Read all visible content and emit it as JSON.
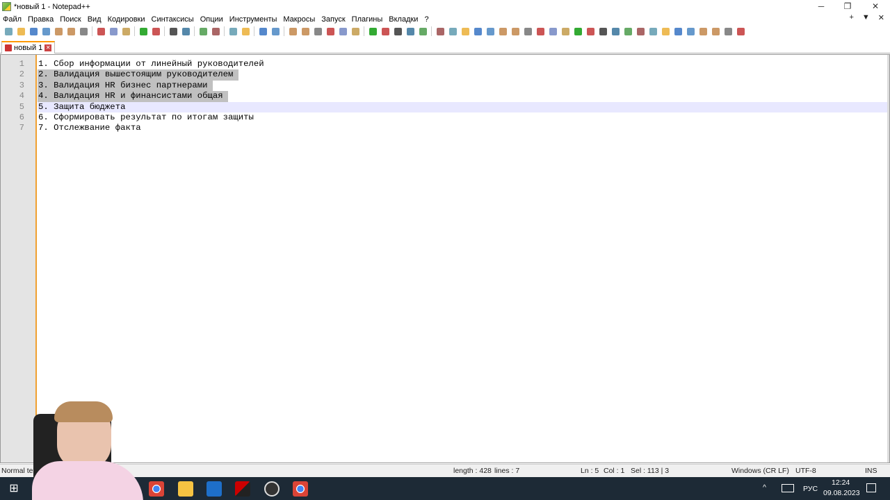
{
  "window": {
    "title": "*новый 1 - Notepad++",
    "minimize": "─",
    "restore": "❐",
    "close": "✕"
  },
  "menu": [
    "Файл",
    "Правка",
    "Поиск",
    "Вид",
    "Кодировки",
    "Синтаксисы",
    "Опции",
    "Инструменты",
    "Макросы",
    "Запуск",
    "Плагины",
    "Вкладки",
    "?"
  ],
  "menu_right": {
    "add": "+",
    "dropdown": "▼",
    "close": "✕"
  },
  "toolbar_icons": [
    "new-file-icon",
    "open-file-icon",
    "save-icon",
    "save-all-icon",
    "close-icon",
    "close-all-icon",
    "print-icon",
    "cut-icon",
    "copy-icon",
    "paste-icon",
    "undo-icon",
    "redo-icon",
    "find-icon",
    "replace-icon",
    "zoom-in-icon",
    "zoom-out-icon",
    "sync-vertical-icon",
    "sync-horizontal-icon",
    "word-wrap-icon",
    "show-all-chars-icon",
    "indent-guide-icon",
    "lang-icon",
    "doc-map-icon",
    "function-list-icon",
    "folder-workspace-icon",
    "monitor-icon",
    "record-macro-icon",
    "stop-macro-icon",
    "play-macro-icon",
    "run-macro-multiple-icon",
    "save-macro-icon",
    "plugin-icon",
    "plugin-icon",
    "plugin-icon",
    "plugin-icon",
    "plugin-icon",
    "plugin-icon",
    "plugin-icon",
    "plugin-icon",
    "plugin-icon",
    "plugin-icon",
    "plugin-icon",
    "plugin-icon",
    "plugin-icon",
    "plugin-icon",
    "plugin-icon",
    "plugin-icon",
    "plugin-icon",
    "plugin-icon",
    "plugin-icon",
    "plugin-icon",
    "plugin-icon",
    "plugin-icon",
    "plugin-icon",
    "plugin-icon",
    "plugin-icon"
  ],
  "tab": {
    "label": "новый 1",
    "close": "✕"
  },
  "editor": {
    "lines": [
      "1. Сбор информации от линейный руководителей",
      "2. Валидация вышестоящим руководителем ",
      "3. Валидация HR бизнес партнерами ",
      "4. Валидация HR и финансистами общая ",
      "5. Защита бюджета",
      "6. Сформировать результат по итогам защиты",
      "7. Отслежвание факта"
    ],
    "selected_lines": [
      2,
      3,
      4
    ],
    "current_line": 5
  },
  "status": {
    "lang": "Normal text file",
    "length": "length : 428",
    "lines": "lines : 7",
    "ln": "Ln : 5",
    "col": "Col : 1",
    "sel": "Sel : 113 | 3",
    "eol": "Windows (CR LF)",
    "encoding": "UTF-8",
    "mode": "INS"
  },
  "taskbar": {
    "lang": "РУС",
    "time": "12:24",
    "date": "09.08.2023",
    "chevron": "^"
  }
}
